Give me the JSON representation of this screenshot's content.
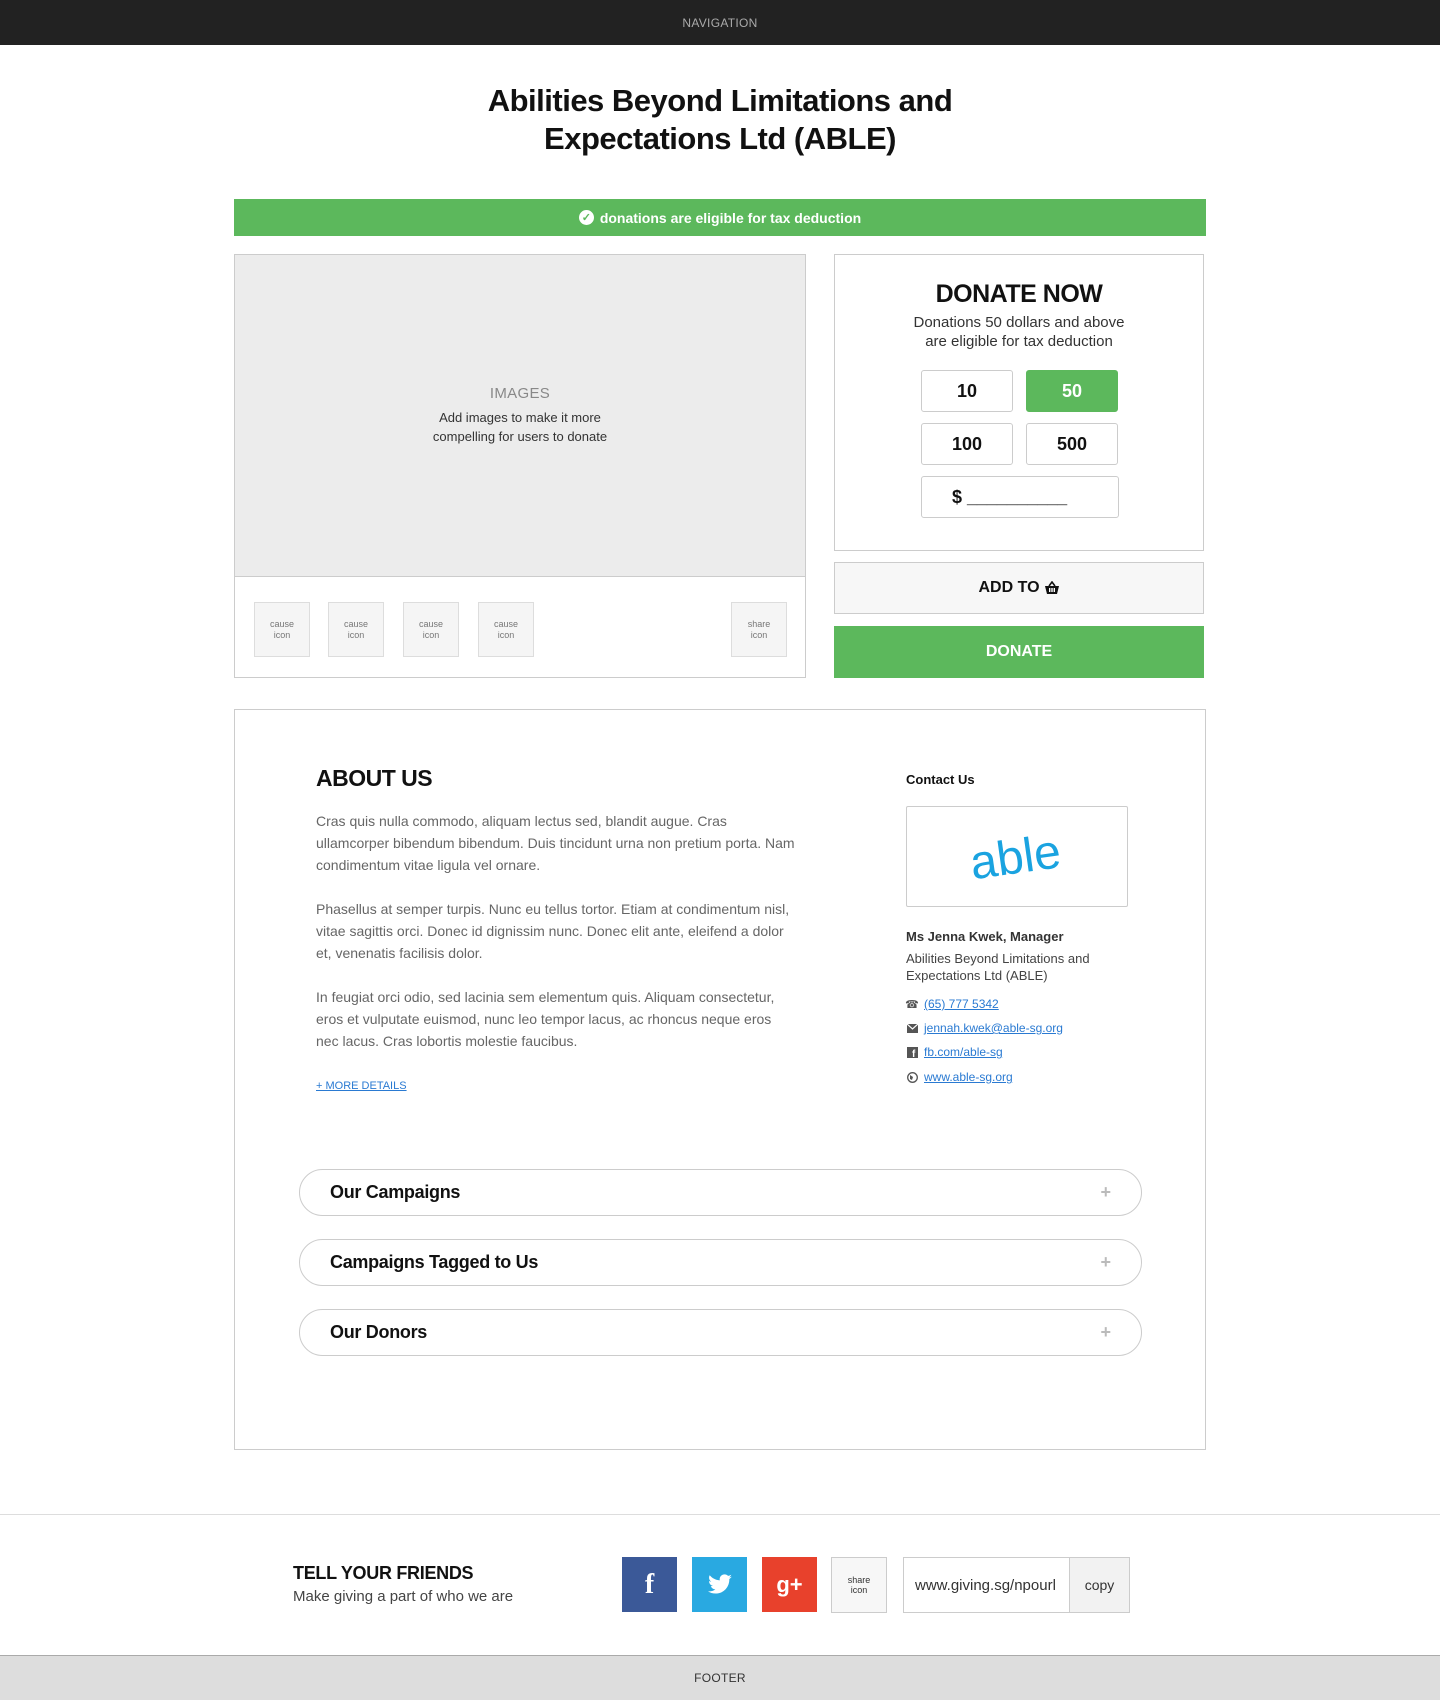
{
  "nav": {
    "label": "NAVIGATION"
  },
  "page_title": {
    "line1": "Abilities Beyond Limitations and",
    "line2": "Expectations Ltd (ABLE)"
  },
  "tax_banner": {
    "icon": "check-circle-icon",
    "text": "donations are eligible for tax deduction"
  },
  "gallery": {
    "title": "IMAGES",
    "sub1": "Add images to make it more",
    "sub2": "compelling for users to donate",
    "thumbs": [
      {
        "line1": "cause",
        "line2": "icon"
      },
      {
        "line1": "cause",
        "line2": "icon"
      },
      {
        "line1": "cause",
        "line2": "icon"
      },
      {
        "line1": "cause",
        "line2": "icon"
      }
    ],
    "share": {
      "line1": "share",
      "line2": "icon"
    }
  },
  "donate_box": {
    "title": "DONATE NOW",
    "sub1": "Donations 50 dollars and above",
    "sub2": "are eligible for tax deduction",
    "amounts": [
      "10",
      "50",
      "100",
      "500"
    ],
    "selected": "50",
    "custom": "$ __________"
  },
  "add_to": {
    "label": "ADD TO",
    "icon": "basket-icon"
  },
  "donate_button": {
    "label": "DONATE"
  },
  "about": {
    "title": "ABOUT US",
    "paragraphs": [
      "Cras quis nulla commodo, aliquam lectus sed, blandit augue. Cras ullamcorper bibendum bibendum. Duis tincidunt urna non pretium porta. Nam condimentum vitae ligula vel ornare.",
      "Phasellus at semper turpis. Nunc eu tellus tortor. Etiam at condimentum nisl, vitae sagittis orci. Donec id dignissim nunc. Donec elit ante, eleifend a dolor et, venenatis facilisis dolor.",
      "In feugiat orci odio, sed lacinia sem elementum quis. Aliquam consectetur, eros et vulputate euismod, nunc leo tempor lacus, ac rhoncus neque eros nec lacus. Cras lobortis molestie faucibus."
    ],
    "more": "+ MORE DETAILS"
  },
  "contact": {
    "title": "Contact Us",
    "logo_text": "able",
    "name": "Ms Jenna Kwek, Manager",
    "org1": "Abilities Beyond Limitations and",
    "org2": "Expectations Ltd (ABLE)",
    "phone": "(65) 777 5342",
    "email": "jennah.kwek@able-sg.org",
    "facebook": "fb.com/able-sg",
    "website": "www.able-sg.org"
  },
  "accordions": [
    {
      "label": "Our Campaigns",
      "icon": "plus-icon"
    },
    {
      "label": "Campaigns Tagged to Us",
      "icon": "plus-icon"
    },
    {
      "label": "Our Donors",
      "icon": "plus-icon"
    }
  ],
  "share_section": {
    "title": "TELL YOUR FRIENDS",
    "sub": "Make giving a part of who we are",
    "share": {
      "line1": "share",
      "line2": "icon"
    },
    "url": "www.giving.sg/npourl",
    "copy": "copy"
  },
  "footer": {
    "label": "FOOTER"
  },
  "colors": {
    "accent_green": "#5cb85c",
    "facebook": "#3b5998",
    "twitter": "#29a9e1",
    "google_plus": "#e8412c",
    "link": "#2a7ad2",
    "logo": "#1aa3e0"
  }
}
